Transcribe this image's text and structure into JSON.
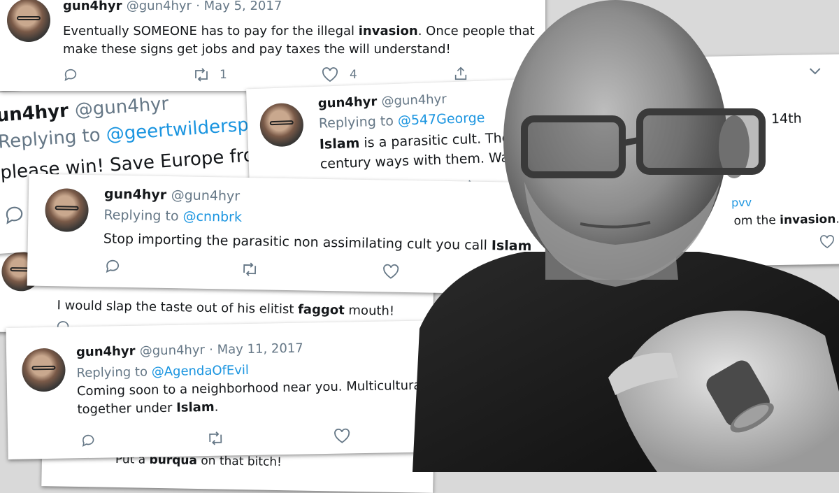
{
  "tweets": [
    {
      "name": "gun4hyr",
      "handle": "@gun4hyr",
      "date": "· May 5, 2017",
      "text1a": "Eventually SOMEONE has to pay for the illegal ",
      "text1b": "invasion",
      "text1c": ". Once people that",
      "text2": "make these signs get jobs and pay taxes the will understand!",
      "retweets": "1",
      "likes": "4"
    },
    {
      "name": "un4hyr",
      "handle": "@gun4hyr",
      "reply_prefix": "Replying to ",
      "reply_to": "@geertwildersp",
      "text1": "please win! Save Europe fro"
    },
    {
      "name": "gun4hyr",
      "handle": "@gun4hyr",
      "reply_prefix": "Replying to ",
      "reply_to": "@547George",
      "text1a": "Islam",
      "text1b": " is a parasitic cult. They",
      "text2": "century ways with them. Wake"
    },
    {
      "right1": "14th",
      "right2_mention": "pvv",
      "right3a": "om the ",
      "right3b": "invasion",
      "right3c": "."
    },
    {
      "name": "gun4hyr",
      "handle": "@gun4hyr",
      "reply_prefix": "Replying to ",
      "reply_to": "@cnnbrk",
      "text1a": "Stop importing the parasitic non assimilating cult you call ",
      "text1b": "Islam"
    },
    {
      "text1a": "I would slap the taste out of his elitist ",
      "text1b": "faggot",
      "text1c": " mouth!"
    },
    {
      "name": "gun4hyr",
      "handle": "@gun4hyr",
      "date": "· May 11, 2017",
      "reply_prefix": "Replying to ",
      "reply_to": "@AgendaOfEvil",
      "text1": "Coming soon to a neighborhood near you. Multiculturalism = we all die",
      "text2a": "together under ",
      "text2b": "Islam",
      "text2c": "."
    },
    {
      "text1a": "Put a ",
      "text1b": "burqua",
      "text1c": " on that bitch!"
    }
  ],
  "colors": {
    "link": "#1b95e0",
    "muted": "#657786",
    "text": "#14171a"
  },
  "icons": [
    "reply-icon",
    "retweet-icon",
    "like-icon",
    "share-icon",
    "chevron-down-icon"
  ]
}
